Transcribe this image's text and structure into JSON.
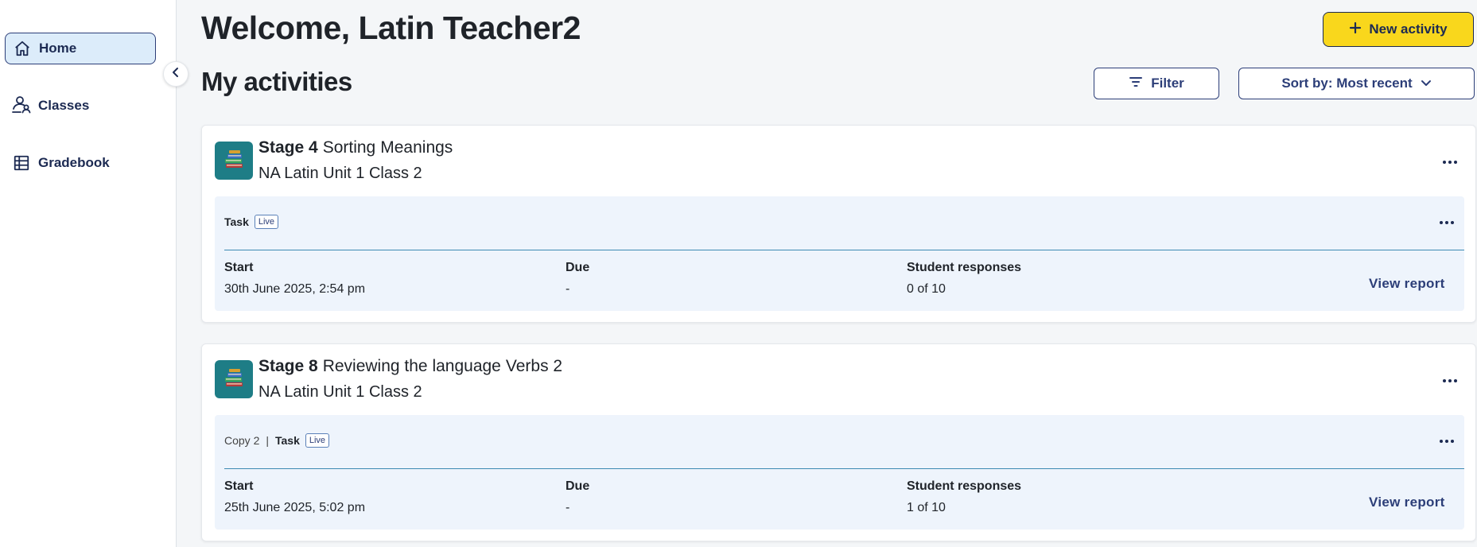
{
  "sidebar": {
    "items": [
      {
        "label": "Home",
        "icon": "home-icon",
        "active": true
      },
      {
        "label": "Classes",
        "icon": "classes-icon",
        "active": false
      },
      {
        "label": "Gradebook",
        "icon": "gradebook-icon",
        "active": false
      }
    ]
  },
  "header": {
    "welcome": "Welcome, Latin Teacher2",
    "new_activity_label": "New activity",
    "section_title": "My activities",
    "filter_label": "Filter",
    "sort_label": "Sort by: Most recent"
  },
  "activities": [
    {
      "stage": "Stage 4",
      "title_parts": [
        "Sorting",
        "Meanings"
      ],
      "class_name": "NA Latin Unit 1 Class 2",
      "copy": "",
      "type": "Task",
      "badge": "Live",
      "start_label": "Start",
      "start": "30th June 2025, 2:54 pm",
      "due_label": "Due",
      "due": "-",
      "responses_label": "Student responses",
      "responses": "0 of 10",
      "view_report": "View report"
    },
    {
      "stage": "Stage 8",
      "title_parts": [
        "Reviewing the language",
        "Verbs 2"
      ],
      "class_name": "NA Latin Unit 1 Class 2",
      "copy": "Copy 2",
      "type": "Task",
      "badge": "Live",
      "start_label": "Start",
      "start": "25th June 2025, 5:02 pm",
      "due_label": "Due",
      "due": "-",
      "responses_label": "Student responses",
      "responses": "1 of 10",
      "view_report": "View report"
    }
  ],
  "colors": {
    "accent_yellow": "#f9d71c",
    "brand_navy": "#1c2a52",
    "active_nav_bg": "#dcecfa",
    "card_inner_bg": "#eef4fc",
    "thumb_teal": "#1e7d86"
  }
}
